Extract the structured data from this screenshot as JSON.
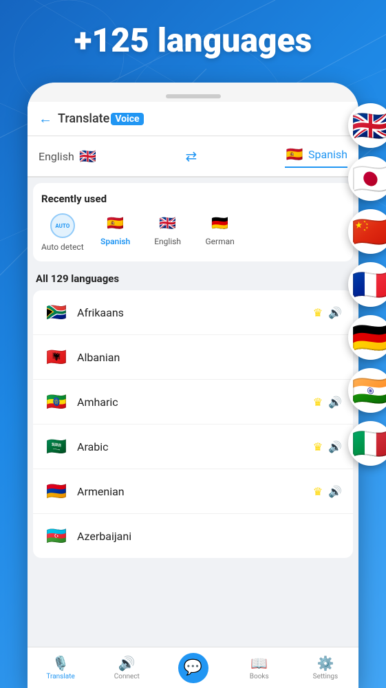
{
  "app": {
    "header_text": "+125 languages",
    "title_translate": "Translate",
    "title_voice": "Voice"
  },
  "language_bar": {
    "source_lang": "English",
    "target_lang": "Spanish",
    "swap_label": "swap"
  },
  "recently_used": {
    "section_title": "Recently used",
    "items": [
      {
        "id": "auto",
        "label": "Auto detect",
        "type": "auto"
      },
      {
        "id": "spanish",
        "label": "Spanish",
        "type": "flag",
        "flag": "🇪🇸",
        "active": true
      },
      {
        "id": "english",
        "label": "English",
        "type": "flag",
        "flag": "🇬🇧"
      },
      {
        "id": "german",
        "label": "German",
        "type": "flag",
        "flag": "🇩🇪"
      }
    ]
  },
  "all_languages": {
    "section_title": "All 129 languages",
    "items": [
      {
        "name": "Afrikaans",
        "flag": "🇿🇦",
        "has_crown": true,
        "has_voice": true
      },
      {
        "name": "Albanian",
        "flag": "🇦🇱",
        "has_crown": false,
        "has_voice": false
      },
      {
        "name": "Amharic",
        "flag": "🇪🇹",
        "has_crown": true,
        "has_voice": true
      },
      {
        "name": "Arabic",
        "flag": "🇸🇦",
        "has_crown": true,
        "has_voice": true
      },
      {
        "name": "Armenian",
        "flag": "🇦🇲",
        "has_crown": true,
        "has_voice": true
      },
      {
        "name": "Azerbaijani",
        "flag": "🇦🇿",
        "has_crown": false,
        "has_voice": false
      }
    ]
  },
  "bottom_nav": {
    "items": [
      {
        "id": "translate",
        "label": "Translate",
        "icon": "🎤",
        "active": true
      },
      {
        "id": "connect",
        "label": "Connect",
        "icon": "🔊",
        "active": false
      },
      {
        "id": "chat",
        "label": "",
        "icon": "💬",
        "center": true
      },
      {
        "id": "books",
        "label": "Books",
        "icon": "📖",
        "active": false
      },
      {
        "id": "settings",
        "label": "Settings",
        "icon": "⚙️",
        "active": false
      }
    ]
  },
  "floating_flags": [
    {
      "id": "uk",
      "flag": "🇬🇧"
    },
    {
      "id": "japan",
      "flag": "🇯🇵"
    },
    {
      "id": "china",
      "flag": "🇨🇳"
    },
    {
      "id": "france",
      "flag": "🇫🇷"
    },
    {
      "id": "germany",
      "flag": "🇩🇪"
    },
    {
      "id": "india",
      "flag": "🇮🇳"
    },
    {
      "id": "italy",
      "flag": "🇮🇹"
    }
  ]
}
